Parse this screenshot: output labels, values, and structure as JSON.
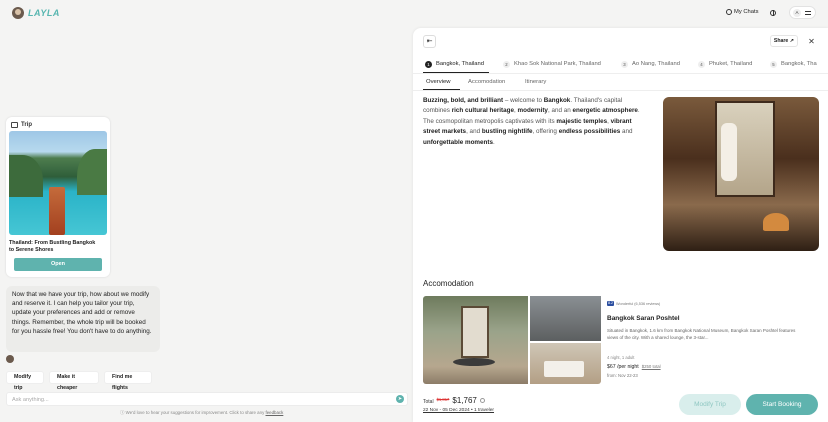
{
  "brand": {
    "name": "LAYLA"
  },
  "header": {
    "my_chats": "My Chats",
    "user_initial": "A"
  },
  "trip_card": {
    "heading": "Trip",
    "title": "Thailand: From Bustling Bangkok to Serene Shores",
    "open_label": "Open"
  },
  "bot_message": "Now that we have your trip, how about we modify and reserve it. I can help you tailor your trip, update your preferences and add or remove things. Remember, the whole trip will be booked for you hassle free! You don't have to do anything.",
  "chips": [
    "Modify trip",
    "Make it cheaper",
    "Find me flights"
  ],
  "chat_input": {
    "placeholder": "Ask anything..."
  },
  "feedback": {
    "text": "We'd love to hear your suggestions for improvement. Click to share any",
    "link": "feedback"
  },
  "panel": {
    "share_label": "Share",
    "destinations": [
      {
        "num": "1",
        "label": "Bangkok, Thailand"
      },
      {
        "num": "2",
        "label": "Khao Sok National Park, Thailand"
      },
      {
        "num": "3",
        "label": "Ao Nang, Thailand"
      },
      {
        "num": "4",
        "label": "Phuket, Thailand"
      },
      {
        "num": "5",
        "label": "Bangkok, Tha"
      }
    ],
    "sub_tabs": [
      "Overview",
      "Accomodation",
      "Itinerary"
    ],
    "overview": {
      "p1": "Buzzing, bold, and brilliant",
      "p2": " – welcome to ",
      "p3": "Bangkok",
      "p4": ". Thailand's capital combines ",
      "p5": "rich cultural heritage",
      "p6": ", ",
      "p7": "modernity",
      "p8": ", and an ",
      "p9": "energetic atmosphere",
      "p10": ". The cosmopolitan metropolis captivates with its ",
      "p11": "majestic temples",
      "p12": ", ",
      "p13": "vibrant street markets",
      "p14": ", and ",
      "p15": "bustling nightlife",
      "p16": ", offering ",
      "p17": "endless possibilities",
      "p18": " and ",
      "p19": "unforgettable moments",
      "p20": "."
    },
    "accommodation": {
      "title": "Accomodation",
      "rating_badge": "8.2",
      "rating_text": "Wonderful (6,536 reviews)",
      "hotel_name": "Bangkok Saran Poshtel",
      "description": "Situated in Bangkok, 1.6 km from Bangkok National Museum, Bangkok Saran Poshtel features views of the city. With a shared lounge, the 3-star...",
      "meta": "4 night, 1 adult",
      "price": "$67 /per night",
      "price_total": "$250 total",
      "dates": "from: Nov 22-23"
    },
    "total": {
      "label": "Total",
      "old": "$1,817",
      "new": "$1,767"
    },
    "trip_dates": "22 Nov - 05 Dec 2024 • 1 traveler",
    "modify_label": "Modify Trip",
    "start_label": "Start Booking"
  }
}
